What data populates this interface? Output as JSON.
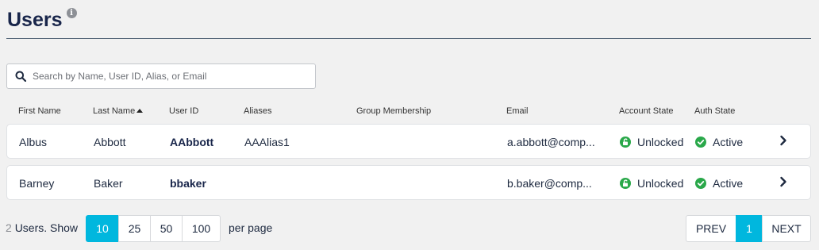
{
  "header": {
    "title": "Users",
    "info_icon": "info-icon"
  },
  "search": {
    "placeholder": "Search by Name, User ID, Alias, or Email",
    "value": ""
  },
  "columns": {
    "first_name": "First Name",
    "last_name": "Last Name",
    "user_id": "User ID",
    "aliases": "Aliases",
    "group_membership": "Group Membership",
    "email": "Email",
    "account_state": "Account State",
    "auth_state": "Auth State",
    "sorted_by": "Last Name",
    "sort_direction": "ascending"
  },
  "rows": [
    {
      "first_name": "Albus",
      "last_name": "Abbott",
      "user_id": "AAbbott",
      "aliases": "AAAlias1",
      "group_membership": "",
      "email": "a.abbott@comp...",
      "account_state": "Unlocked",
      "auth_state": "Active"
    },
    {
      "first_name": "Barney",
      "last_name": "Baker",
      "user_id": "bbaker",
      "aliases": "",
      "group_membership": "",
      "email": "b.baker@comp...",
      "account_state": "Unlocked",
      "auth_state": "Active"
    }
  ],
  "footer": {
    "count": "2",
    "users_show": "Users. Show",
    "page_sizes": [
      "10",
      "25",
      "50",
      "100"
    ],
    "selected_page_size": "10",
    "per_page": "per page",
    "prev": "PREV",
    "current_page": "1",
    "next": "NEXT"
  },
  "colors": {
    "accent": "#00b7de",
    "status_green": "#2aa84a",
    "title": "#18254a"
  }
}
